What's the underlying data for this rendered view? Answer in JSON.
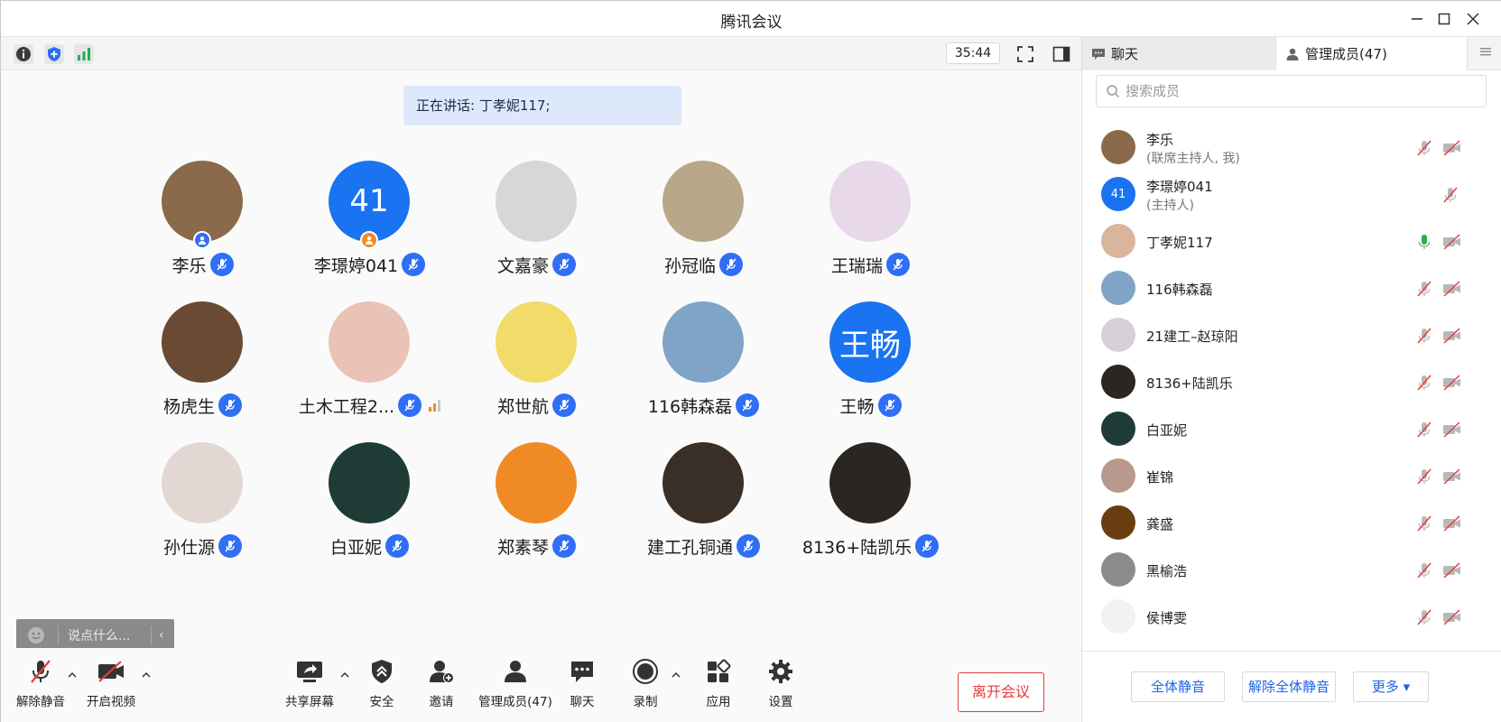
{
  "window": {
    "title": "腾讯会议"
  },
  "topbar": {
    "timer": "35:44"
  },
  "stage": {
    "speaking": "正在讲话: 丁孝妮117;",
    "tiles": [
      {
        "name": "李乐",
        "avatar_text": "",
        "avatar_color": "#8a6a4a",
        "host_badge": "#2f6ef5"
      },
      {
        "name": "李璟婷041",
        "avatar_text": "41",
        "avatar_color": "#1a73f0",
        "host_badge": "#f08a24"
      },
      {
        "name": "文嘉豪",
        "avatar_text": "",
        "avatar_color": "#d7d7d7"
      },
      {
        "name": "孙冠临",
        "avatar_text": "",
        "avatar_color": "#b9a78a"
      },
      {
        "name": "王瑞瑞",
        "avatar_text": "",
        "avatar_color": "#e8d8ea"
      },
      {
        "name": "杨虎生",
        "avatar_text": "",
        "avatar_color": "#6a4a32"
      },
      {
        "name": "土木工程2...",
        "avatar_text": "",
        "avatar_color": "#e9c3b6",
        "signal": true
      },
      {
        "name": "郑世航",
        "avatar_text": "",
        "avatar_color": "#f1dc6a"
      },
      {
        "name": "116韩森磊",
        "avatar_text": "",
        "avatar_color": "#7fa4c6"
      },
      {
        "name": "王畅",
        "avatar_text": "王畅",
        "avatar_color": "#1a73f0"
      },
      {
        "name": "孙仕源",
        "avatar_text": "",
        "avatar_color": "#e3d7d3"
      },
      {
        "name": "白亚妮",
        "avatar_text": "",
        "avatar_color": "#1f3b36"
      },
      {
        "name": "郑素琴",
        "avatar_text": "",
        "avatar_color": "#f08a24"
      },
      {
        "name": "建工孔铜通",
        "avatar_text": "",
        "avatar_color": "#3a2f26"
      },
      {
        "name": "8136+陆凯乐",
        "avatar_text": "",
        "avatar_color": "#2c2622"
      }
    ]
  },
  "reaction": {
    "placeholder": "说点什么..."
  },
  "toolbar": {
    "unmute": "解除静音",
    "video": "开启视频",
    "share": "共享屏幕",
    "security": "安全",
    "invite": "邀请",
    "members": "管理成员(47)",
    "chat": "聊天",
    "record": "录制",
    "apps": "应用",
    "settings": "设置",
    "leave": "离开会议"
  },
  "panel": {
    "tab_chat": "聊天",
    "tab_members": "管理成员(47)",
    "search_placeholder": "搜索成员",
    "members": [
      {
        "name": "李乐",
        "role": "(联席主持人, 我)",
        "avatar_text": "",
        "avatar_color": "#8a6a4a",
        "mic": "muted"
      },
      {
        "name": "李璟婷041",
        "role": "(主持人)",
        "avatar_text": "41",
        "avatar_color": "#1a73f0",
        "mic": "muted",
        "no_video": true
      },
      {
        "name": "丁孝妮117",
        "role": "",
        "avatar_text": "",
        "avatar_color": "#d9b59b",
        "mic": "active"
      },
      {
        "name": "116韩森磊",
        "role": "",
        "avatar_text": "",
        "avatar_color": "#7fa4c6",
        "mic": "muted"
      },
      {
        "name": "21建工–赵琼阳",
        "role": "",
        "avatar_text": "",
        "avatar_color": "#d8cfd6",
        "mic": "muted"
      },
      {
        "name": "8136+陆凯乐",
        "role": "",
        "avatar_text": "",
        "avatar_color": "#2c2622",
        "mic": "muted"
      },
      {
        "name": "白亚妮",
        "role": "",
        "avatar_text": "",
        "avatar_color": "#1f3b36",
        "mic": "muted"
      },
      {
        "name": "崔锦",
        "role": "",
        "avatar_text": "",
        "avatar_color": "#b89a8d",
        "mic": "muted"
      },
      {
        "name": "龚盛",
        "role": "",
        "avatar_text": "",
        "avatar_color": "#6a3d10",
        "mic": "muted"
      },
      {
        "name": "黑榆浩",
        "role": "",
        "avatar_text": "",
        "avatar_color": "#8c8c8c",
        "mic": "muted"
      },
      {
        "name": "侯博雯",
        "role": "",
        "avatar_text": "",
        "avatar_color": "#f2f2f2",
        "mic": "muted"
      }
    ],
    "mute_all": "全体静音",
    "unmute_all": "解除全体静音",
    "more": "更多 ▾"
  },
  "colors": {
    "accent": "#2f6ef5",
    "leave": "#e63b3b",
    "speaking_bg": "#dde9fb"
  }
}
